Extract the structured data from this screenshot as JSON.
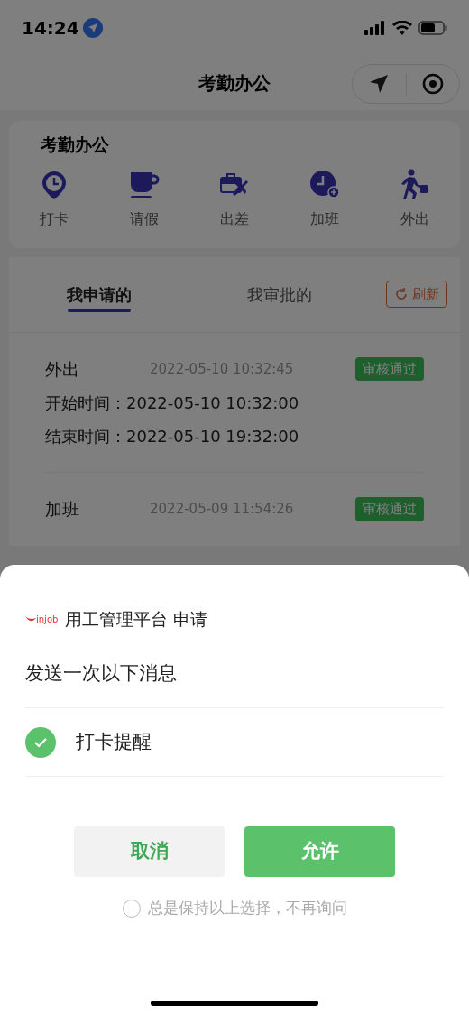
{
  "status_bar": {
    "time": "14:24"
  },
  "nav": {
    "title": "考勤办公"
  },
  "section": {
    "title": "考勤办公",
    "shortcuts": [
      {
        "kind": "punch",
        "label": "打卡"
      },
      {
        "kind": "leave",
        "label": "请假"
      },
      {
        "kind": "trip",
        "label": "出差"
      },
      {
        "kind": "overtime",
        "label": "加班"
      },
      {
        "kind": "outing",
        "label": "外出"
      }
    ]
  },
  "tabs": [
    {
      "label": "我申请的",
      "selected": true
    },
    {
      "label": "我审批的",
      "selected": false
    }
  ],
  "refresh_button": "刷新",
  "records": [
    {
      "type": "外出",
      "submitted": "2022-05-10 10:32:45",
      "status": "审核通过",
      "fields": [
        {
          "label": "开始时间：",
          "value": "2022-05-10 10:32:00"
        },
        {
          "label": "结束时间：",
          "value": "2022-05-10 19:32:00"
        }
      ]
    },
    {
      "type": "加班",
      "submitted": "2022-05-09 11:54:26",
      "status": "审核通过"
    }
  ],
  "dialog": {
    "logo": "injob",
    "app_title": "用工管理平台 申请",
    "heading": "发送一次以下消息",
    "options": [
      {
        "label": "打卡提醒",
        "checked": true
      }
    ],
    "cancel_button": "取消",
    "allow_button": "允许",
    "remember": {
      "label": "总是保持以上选择，不再询问",
      "checked": false
    }
  }
}
